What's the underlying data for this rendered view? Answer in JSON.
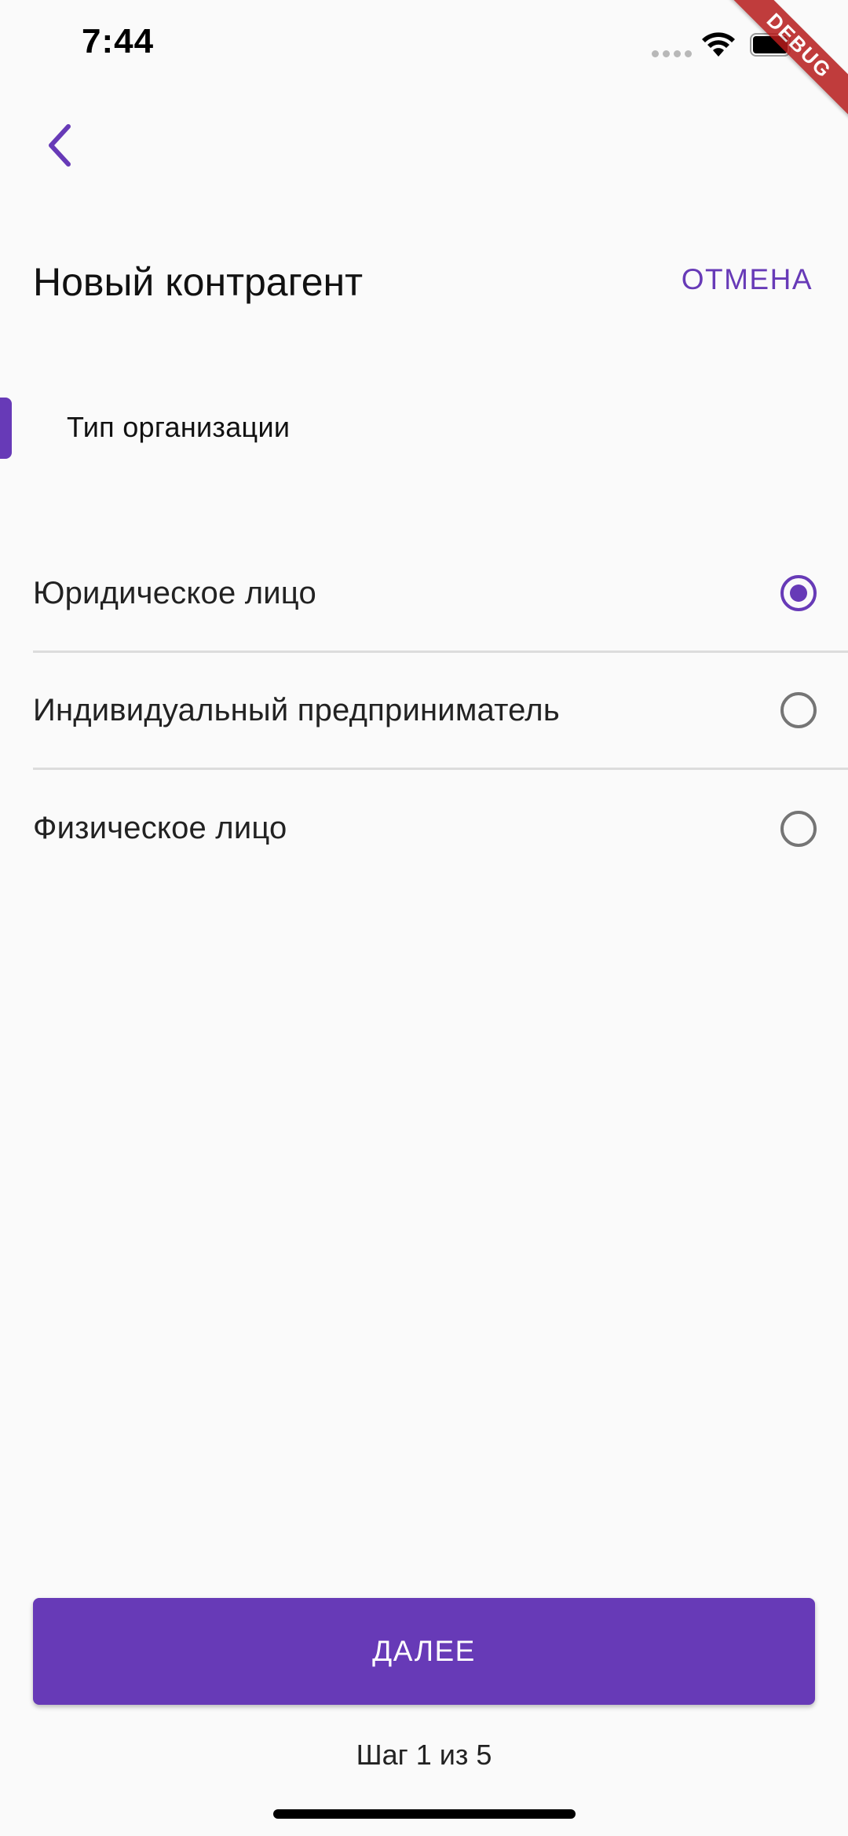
{
  "status_bar": {
    "time": "7:44",
    "wifi_icon": "wifi-icon",
    "battery_icon": "battery-icon"
  },
  "debug_banner": "DEBUG",
  "back_icon": "chevron-left-icon",
  "header": {
    "title": "Новый контрагент",
    "cancel_label": "ОТМЕНА"
  },
  "section": {
    "label": "Тип организации"
  },
  "options": [
    {
      "label": "Юридическое лицо",
      "selected": true
    },
    {
      "label": "Индивидуальный предприниматель",
      "selected": false
    },
    {
      "label": "Физическое лицо",
      "selected": false
    }
  ],
  "footer": {
    "next_label": "ДАЛЕЕ",
    "step_text": "Шаг 1 из 5"
  },
  "colors": {
    "accent": "#673ab7",
    "background": "#fafafa",
    "divider": "#dcdcdc",
    "radio_inactive": "#757575"
  }
}
